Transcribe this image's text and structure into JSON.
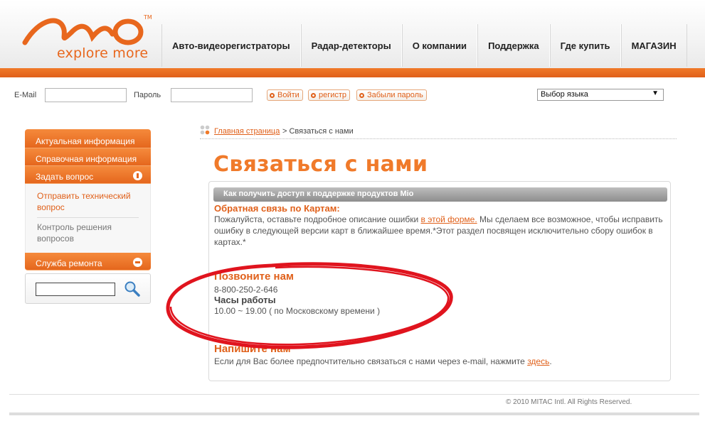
{
  "brand": {
    "logo_text": "explore more"
  },
  "nav": [
    "Авто-видеорегистраторы",
    "Радар-детекторы",
    "О компании",
    "Поддержка",
    "Где купить",
    "МАГАЗИН"
  ],
  "login": {
    "email_label": "E-Mail",
    "password_label": "Пароль",
    "buttons": [
      "Войти",
      "регистр",
      "Забыли пароль"
    ],
    "language_select": "Выбор языка"
  },
  "sidebar": {
    "items": [
      "Актуальная информация",
      "Справочная информация",
      "Задать вопрос"
    ],
    "sub_items": [
      "Отправить технический вопрос",
      "Контроль решения вопросов"
    ],
    "repair": "Служба ремонта"
  },
  "breadcrumb": {
    "home": "Главная страница",
    "current": "> Связаться с нами"
  },
  "page_title": "Связаться с нами",
  "panel": {
    "header": "Как получить доступ к поддержке продуктов Mio",
    "feedback": {
      "title": "Обратная связь по Картам:",
      "text_before": "Пожалуйста, оставьте подробное описание ошибки ",
      "link": "в этой форме.",
      "text_after": "  Мы сделаем все возможное, чтобы исправить ошибку в следующей версии карт в ближайшее время.*Этот раздел посвящен исключительно сбору ошибок в картах.*"
    },
    "call": {
      "title": "Позвоните нам",
      "phone": "8-800-250-2-646",
      "hours_label": "Часы работы",
      "hours": "10.00 ~ 19.00 ( по Московскому времени )"
    },
    "write": {
      "title": "Напишите нам",
      "text": "Если для Вас более предпочтительно связаться с нами через e-mail, нажмите ",
      "link": "здесь",
      "end": "."
    }
  },
  "footer": {
    "copyright": "© 2010 MITAC Intl. All Rights Reserved."
  },
  "colors": {
    "accent": "#e0601a",
    "annotation": "#e0141e"
  }
}
